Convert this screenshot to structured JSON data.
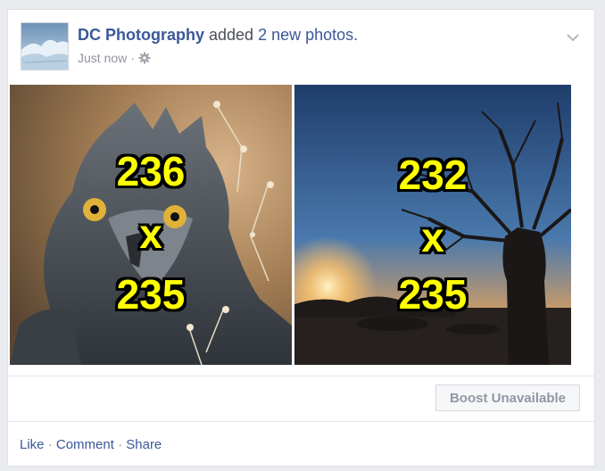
{
  "post": {
    "page_name": "DC Photography",
    "action_text": "added",
    "photo_count_text": "2 new photos.",
    "timestamp": "Just now",
    "separator": "·",
    "privacy_icon": "gear-icon",
    "menu_icon": "chevron-down-icon"
  },
  "photos": [
    {
      "subject": "eagle",
      "dim_top": "236",
      "dim_x": "x",
      "dim_bottom": "235"
    },
    {
      "subject": "baobab-tree-sunset",
      "dim_top": "232",
      "dim_x": "x",
      "dim_bottom": "235"
    }
  ],
  "boost": {
    "label": "Boost Unavailable"
  },
  "actions": {
    "like": "Like",
    "comment": "Comment",
    "share": "Share",
    "separator": "·"
  },
  "colors": {
    "link_blue": "#3b5998",
    "meta_gray": "#90949c",
    "overlay_text": "#ffff00"
  }
}
